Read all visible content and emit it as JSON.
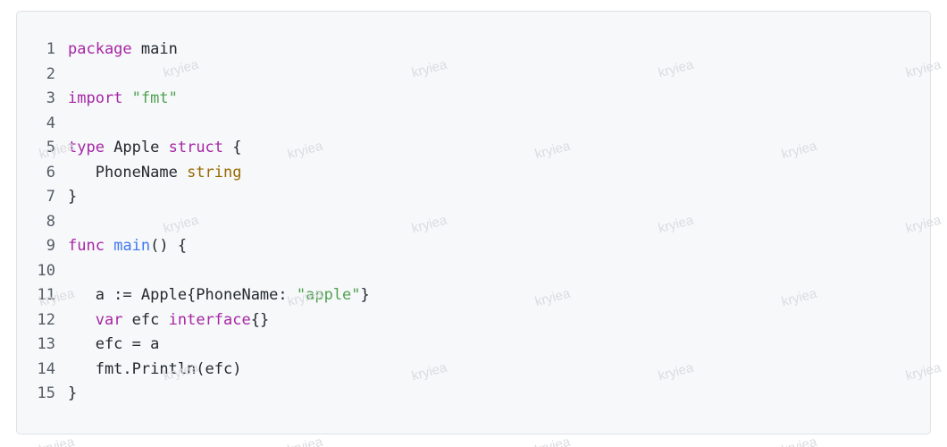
{
  "code_block": {
    "language": "go",
    "lines": [
      {
        "n": "1",
        "tokens": [
          {
            "t": "package",
            "c": "kw"
          },
          {
            "t": " main",
            "c": "id"
          }
        ]
      },
      {
        "n": "2",
        "tokens": []
      },
      {
        "n": "3",
        "tokens": [
          {
            "t": "import",
            "c": "kw"
          },
          {
            "t": " ",
            "c": "id"
          },
          {
            "t": "\"fmt\"",
            "c": "str"
          }
        ]
      },
      {
        "n": "4",
        "tokens": []
      },
      {
        "n": "5",
        "tokens": [
          {
            "t": "type",
            "c": "kw"
          },
          {
            "t": " Apple ",
            "c": "id"
          },
          {
            "t": "struct",
            "c": "kw"
          },
          {
            "t": " {",
            "c": "pun"
          }
        ]
      },
      {
        "n": "6",
        "tokens": [
          {
            "t": "   PhoneName ",
            "c": "id"
          },
          {
            "t": "string",
            "c": "typ"
          }
        ]
      },
      {
        "n": "7",
        "tokens": [
          {
            "t": "}",
            "c": "pun"
          }
        ]
      },
      {
        "n": "8",
        "tokens": []
      },
      {
        "n": "9",
        "tokens": [
          {
            "t": "func",
            "c": "kw"
          },
          {
            "t": " ",
            "c": "id"
          },
          {
            "t": "main",
            "c": "fn"
          },
          {
            "t": "() {",
            "c": "pun"
          }
        ]
      },
      {
        "n": "10",
        "tokens": []
      },
      {
        "n": "11",
        "tokens": [
          {
            "t": "   a := Apple{PhoneName: ",
            "c": "id"
          },
          {
            "t": "\"apple\"",
            "c": "str"
          },
          {
            "t": "}",
            "c": "pun"
          }
        ]
      },
      {
        "n": "12",
        "tokens": [
          {
            "t": "   ",
            "c": "id"
          },
          {
            "t": "var",
            "c": "kw"
          },
          {
            "t": " efc ",
            "c": "id"
          },
          {
            "t": "interface",
            "c": "kw"
          },
          {
            "t": "{}",
            "c": "pun"
          }
        ]
      },
      {
        "n": "13",
        "tokens": [
          {
            "t": "   efc = a",
            "c": "id"
          }
        ]
      },
      {
        "n": "14",
        "tokens": [
          {
            "t": "   fmt.Println(efc)",
            "c": "id"
          }
        ]
      },
      {
        "n": "15",
        "tokens": [
          {
            "t": "}",
            "c": "pun"
          }
        ]
      }
    ]
  },
  "watermark": {
    "text": "kryiea"
  },
  "colors": {
    "keyword": "#a626a4",
    "string": "#50a14f",
    "type": "#986801",
    "function": "#4078f2",
    "text": "#24292e",
    "line_number": "#555c66",
    "background": "#f6f8fa"
  }
}
